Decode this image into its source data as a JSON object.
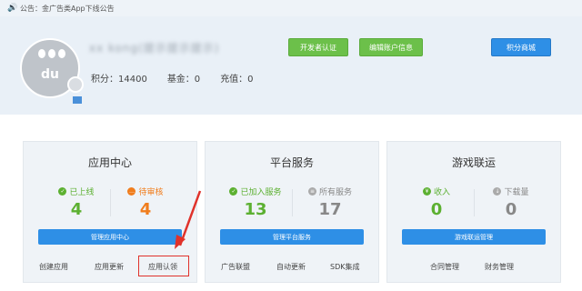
{
  "notice": {
    "text": "公告：金广告类App下线公告"
  },
  "profile": {
    "username": "xx kong(提示提示提示)",
    "avatar_text": "du",
    "points_label": "积分：14400",
    "fund_label": "基金：0",
    "recharge_label": "充值：0"
  },
  "header_buttons": {
    "dev_cert": "开发者认证",
    "edit_account": "编辑账户信息",
    "points_mall": "积分商城"
  },
  "cards": [
    {
      "title": "应用中心",
      "left": {
        "label": "已上线",
        "value": "4",
        "color": "#5cb031"
      },
      "right": {
        "label": "待审核",
        "value": "4",
        "color": "#f07d1d"
      },
      "action": "管理应用中心",
      "links": [
        "创建应用",
        "应用更新",
        "应用认领"
      ]
    },
    {
      "title": "平台服务",
      "left": {
        "label": "已加入服务",
        "value": "13",
        "color": "#5cb031"
      },
      "right": {
        "label": "所有服务",
        "value": "17",
        "color": "#999999"
      },
      "action": "管理平台服务",
      "links": [
        "广告联盟",
        "自动更新",
        "SDK集成"
      ]
    },
    {
      "title": "游戏联运",
      "left": {
        "label": "收入",
        "value": "0",
        "color": "#5cb031"
      },
      "right": {
        "label": "下载量",
        "value": "0",
        "color": "#999999"
      },
      "action": "游戏联运管理",
      "links": [
        "合同管理",
        "财务管理"
      ]
    }
  ],
  "colors": {
    "accent_blue": "#2e8fe6",
    "accent_green": "#6cc04a",
    "highlight_red": "#e0322b"
  }
}
